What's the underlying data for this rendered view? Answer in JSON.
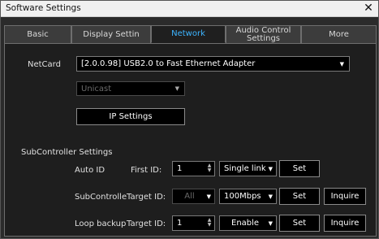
{
  "window": {
    "title": "Software Settings",
    "close_glyph": "✕"
  },
  "tabs": [
    {
      "label": "Basic",
      "active": false
    },
    {
      "label": "Display Settin",
      "active": false
    },
    {
      "label": "Network",
      "active": true
    },
    {
      "label": "Audio Control Settings",
      "active": false
    },
    {
      "label": "More",
      "active": false
    }
  ],
  "network": {
    "netcard_label": "NetCard",
    "netcard_value": "[2.0.0.98] USB2.0 to Fast Ethernet Adapter",
    "cast_value": "Unicast",
    "ip_settings_label": "IP Settings"
  },
  "subcontroller": {
    "section_label": "SubController Settings",
    "auto_id": {
      "label": "Auto ID",
      "field_label": "First ID:",
      "value": "1",
      "mode": "Single link",
      "set_label": "Set"
    },
    "subcontroller_row": {
      "label": "SubControlle",
      "field_label": "Target ID:",
      "target_value": "All",
      "speed": "100Mbps",
      "set_label": "Set",
      "inquire_label": "Inquire"
    },
    "loop_backup": {
      "label": "Loop backup",
      "field_label": "Target ID:",
      "value": "1",
      "mode": "Enable",
      "set_label": "Set",
      "inquire_label": "Inquire"
    }
  },
  "colors": {
    "accent_tab": "#3db4ff",
    "panel_bg": "#1e1e1e",
    "field_bg": "#000000"
  },
  "icons": {
    "dropdown": "chevron-down-icon",
    "spinner": "spinner-arrows-icon",
    "close": "close-icon"
  }
}
